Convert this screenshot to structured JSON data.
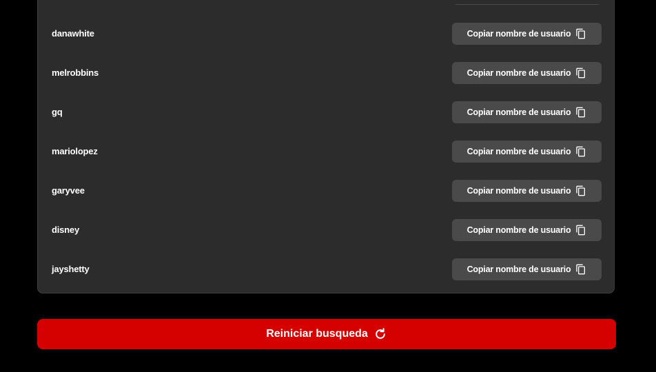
{
  "results": {
    "copy_label": "Copiar nombre de usuario",
    "copy_icon": "copy-icon",
    "users": [
      {
        "username": "danawhite"
      },
      {
        "username": "melrobbins"
      },
      {
        "username": "gq"
      },
      {
        "username": "mariolopez"
      },
      {
        "username": "garyvee"
      },
      {
        "username": "disney"
      },
      {
        "username": "jayshetty"
      }
    ]
  },
  "reset": {
    "label": "Reiniciar busqueda",
    "icon": "refresh-icon"
  },
  "colors": {
    "background": "#000000",
    "panel": "#2c2c2c",
    "copy_button": "#4a4a4a",
    "accent": "#d50000",
    "text": "#ffffff"
  }
}
